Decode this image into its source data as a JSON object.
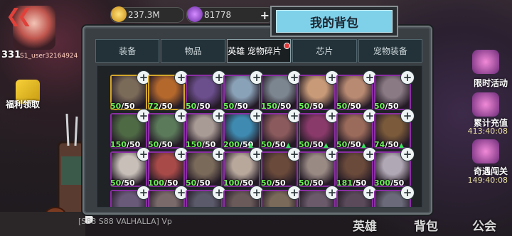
{
  "hud": {
    "back_glyph": "❮❮",
    "level": "331",
    "username": "S1_user32164924",
    "coins": "237.3M",
    "gems": "81778",
    "add_glyph": "+",
    "left_event": "福利领取",
    "chat_preview": "[S88 S88 VALHALLA] Vp"
  },
  "right_events": [
    {
      "label": "限时活动",
      "timer": ""
    },
    {
      "label": "累计充值",
      "timer": "413:40:08"
    },
    {
      "label": "奇遇闯关",
      "timer": "149:40:08"
    }
  ],
  "bottom_nav": {
    "heroes": "英雄",
    "backpack": "背包",
    "guild": "公会"
  },
  "window": {
    "title": "我的背包",
    "tabs": [
      {
        "label": "装备",
        "active": false,
        "badge": false
      },
      {
        "label": "物品",
        "active": false,
        "badge": false
      },
      {
        "label": "英雄 宠物碎片",
        "active": true,
        "badge": true
      },
      {
        "label": "芯片",
        "active": false,
        "badge": false
      },
      {
        "label": "宠物装备",
        "active": false,
        "badge": false
      }
    ],
    "fragments": [
      {
        "have": "50",
        "need": "50",
        "frame": "gold",
        "arrow": false
      },
      {
        "have": "72",
        "need": "50",
        "frame": "gold",
        "arrow": false
      },
      {
        "have": "50",
        "need": "50",
        "frame": "purple",
        "arrow": false
      },
      {
        "have": "50",
        "need": "50",
        "frame": "purple",
        "arrow": false
      },
      {
        "have": "150",
        "need": "50",
        "frame": "purple",
        "arrow": false
      },
      {
        "have": "50",
        "need": "50",
        "frame": "purple",
        "arrow": false
      },
      {
        "have": "50",
        "need": "50",
        "frame": "purple",
        "arrow": false
      },
      {
        "have": "50",
        "need": "50",
        "frame": "purple",
        "arrow": false
      },
      {
        "have": "150",
        "need": "50",
        "frame": "purple",
        "arrow": false
      },
      {
        "have": "50",
        "need": "50",
        "frame": "purple",
        "arrow": false
      },
      {
        "have": "150",
        "need": "50",
        "frame": "purple",
        "arrow": false
      },
      {
        "have": "200",
        "need": "50",
        "frame": "purple",
        "arrow": true
      },
      {
        "have": "50",
        "need": "50",
        "frame": "purple",
        "arrow": true
      },
      {
        "have": "50",
        "need": "50",
        "frame": "purple",
        "arrow": true
      },
      {
        "have": "50",
        "need": "50",
        "frame": "purple",
        "arrow": true
      },
      {
        "have": "74",
        "need": "50",
        "frame": "purple",
        "arrow": true
      },
      {
        "have": "50",
        "need": "50",
        "frame": "purple",
        "arrow": false
      },
      {
        "have": "100",
        "need": "50",
        "frame": "purple",
        "arrow": false
      },
      {
        "have": "50",
        "need": "50",
        "frame": "purple",
        "arrow": false
      },
      {
        "have": "100",
        "need": "50",
        "frame": "purple",
        "arrow": false
      },
      {
        "have": "50",
        "need": "50",
        "frame": "purple",
        "arrow": false
      },
      {
        "have": "50",
        "need": "50",
        "frame": "purple",
        "arrow": false
      },
      {
        "have": "181",
        "need": "50",
        "frame": "purple",
        "arrow": false
      },
      {
        "have": "300",
        "need": "50",
        "frame": "purple",
        "arrow": false
      },
      {
        "have": "",
        "need": "",
        "frame": "purple",
        "arrow": false
      },
      {
        "have": "",
        "need": "",
        "frame": "purple",
        "arrow": false
      },
      {
        "have": "",
        "need": "",
        "frame": "purple",
        "arrow": false
      },
      {
        "have": "",
        "need": "",
        "frame": "purple",
        "arrow": false
      },
      {
        "have": "",
        "need": "",
        "frame": "purple",
        "arrow": false
      },
      {
        "have": "",
        "need": "",
        "frame": "purple",
        "arrow": false
      },
      {
        "have": "",
        "need": "",
        "frame": "purple",
        "arrow": false
      },
      {
        "have": "",
        "need": "",
        "frame": "purple",
        "arrow": false
      }
    ],
    "portrait_tints": [
      "#7a6a58",
      "#b4682c",
      "#6b4e8c",
      "#8aa2b8",
      "#7c8690",
      "#c89a78",
      "#b98a72",
      "#8a7a84",
      "#4e6a44",
      "#5b7a5a",
      "#a89a94",
      "#3e8ab0",
      "#8a5a5c",
      "#8a3a6a",
      "#9a6a5a",
      "#7a5a3a",
      "#c8c0b8",
      "#a84a48",
      "#7a6a5a",
      "#b8a89c",
      "#6a4a3a",
      "#9a8a84",
      "#6a4a3a",
      "#b0a8b4",
      "#6a5a7a",
      "#7a6a6a",
      "#5a5a6a",
      "#6a5a5a",
      "#7a6a5a",
      "#6a5a6a",
      "#5a4a5a",
      "#6a6a7a"
    ]
  },
  "colors": {
    "tab_active": "#1a1f22",
    "title_bg": "#7fd1ea",
    "frame_purple": "#8a2ea3",
    "frame_gold": "#d4a72c",
    "count_have": "#6df05a"
  }
}
